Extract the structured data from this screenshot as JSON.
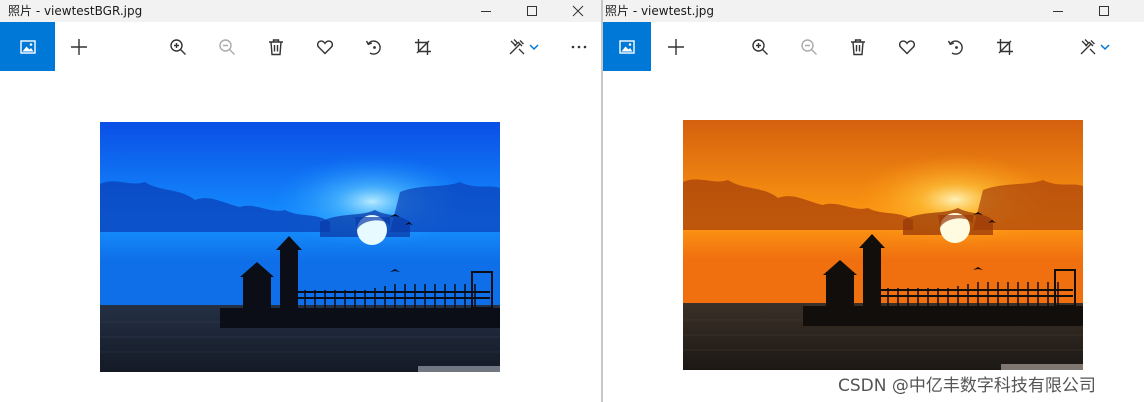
{
  "left_window": {
    "title": "照片 - viewtestBGR.jpg"
  },
  "right_window": {
    "title": "照片 - viewtest.jpg"
  },
  "icons": {
    "app": "photos-app-icon",
    "add": "plus-icon",
    "zoom_in": "zoom-in-icon",
    "zoom_out": "zoom-out-icon",
    "delete": "trash-icon",
    "favorite": "heart-icon",
    "rotate": "rotate-icon",
    "crop": "crop-icon",
    "edit": "edit-create-icon",
    "dropdown": "chevron-down-icon",
    "more": "ellipsis-icon",
    "minimize": "minimize-icon",
    "maximize": "maximize-icon",
    "close": "close-icon"
  },
  "colors": {
    "accent": "#0078d7",
    "titlebar": "#f2f2f2",
    "bgr_sky_top": "#0a48e0",
    "bgr_sky_bottom": "#1aa8ff",
    "rgb_sky_top": "#d25e10",
    "rgb_sky_bottom": "#ffa61a"
  },
  "watermark": "CSDN @中亿丰数字科技有限公司"
}
